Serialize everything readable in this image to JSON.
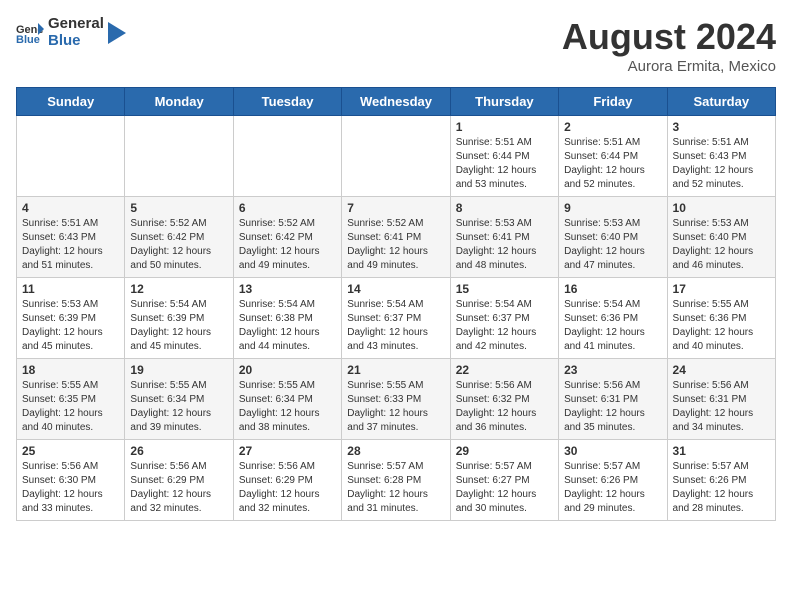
{
  "header": {
    "logo_general": "General",
    "logo_blue": "Blue",
    "month_title": "August 2024",
    "location": "Aurora Ermita, Mexico"
  },
  "weekdays": [
    "Sunday",
    "Monday",
    "Tuesday",
    "Wednesday",
    "Thursday",
    "Friday",
    "Saturday"
  ],
  "weeks": [
    [
      {
        "day": "",
        "info": ""
      },
      {
        "day": "",
        "info": ""
      },
      {
        "day": "",
        "info": ""
      },
      {
        "day": "",
        "info": ""
      },
      {
        "day": "1",
        "info": "Sunrise: 5:51 AM\nSunset: 6:44 PM\nDaylight: 12 hours\nand 53 minutes."
      },
      {
        "day": "2",
        "info": "Sunrise: 5:51 AM\nSunset: 6:44 PM\nDaylight: 12 hours\nand 52 minutes."
      },
      {
        "day": "3",
        "info": "Sunrise: 5:51 AM\nSunset: 6:43 PM\nDaylight: 12 hours\nand 52 minutes."
      }
    ],
    [
      {
        "day": "4",
        "info": "Sunrise: 5:51 AM\nSunset: 6:43 PM\nDaylight: 12 hours\nand 51 minutes."
      },
      {
        "day": "5",
        "info": "Sunrise: 5:52 AM\nSunset: 6:42 PM\nDaylight: 12 hours\nand 50 minutes."
      },
      {
        "day": "6",
        "info": "Sunrise: 5:52 AM\nSunset: 6:42 PM\nDaylight: 12 hours\nand 49 minutes."
      },
      {
        "day": "7",
        "info": "Sunrise: 5:52 AM\nSunset: 6:41 PM\nDaylight: 12 hours\nand 49 minutes."
      },
      {
        "day": "8",
        "info": "Sunrise: 5:53 AM\nSunset: 6:41 PM\nDaylight: 12 hours\nand 48 minutes."
      },
      {
        "day": "9",
        "info": "Sunrise: 5:53 AM\nSunset: 6:40 PM\nDaylight: 12 hours\nand 47 minutes."
      },
      {
        "day": "10",
        "info": "Sunrise: 5:53 AM\nSunset: 6:40 PM\nDaylight: 12 hours\nand 46 minutes."
      }
    ],
    [
      {
        "day": "11",
        "info": "Sunrise: 5:53 AM\nSunset: 6:39 PM\nDaylight: 12 hours\nand 45 minutes."
      },
      {
        "day": "12",
        "info": "Sunrise: 5:54 AM\nSunset: 6:39 PM\nDaylight: 12 hours\nand 45 minutes."
      },
      {
        "day": "13",
        "info": "Sunrise: 5:54 AM\nSunset: 6:38 PM\nDaylight: 12 hours\nand 44 minutes."
      },
      {
        "day": "14",
        "info": "Sunrise: 5:54 AM\nSunset: 6:37 PM\nDaylight: 12 hours\nand 43 minutes."
      },
      {
        "day": "15",
        "info": "Sunrise: 5:54 AM\nSunset: 6:37 PM\nDaylight: 12 hours\nand 42 minutes."
      },
      {
        "day": "16",
        "info": "Sunrise: 5:54 AM\nSunset: 6:36 PM\nDaylight: 12 hours\nand 41 minutes."
      },
      {
        "day": "17",
        "info": "Sunrise: 5:55 AM\nSunset: 6:36 PM\nDaylight: 12 hours\nand 40 minutes."
      }
    ],
    [
      {
        "day": "18",
        "info": "Sunrise: 5:55 AM\nSunset: 6:35 PM\nDaylight: 12 hours\nand 40 minutes."
      },
      {
        "day": "19",
        "info": "Sunrise: 5:55 AM\nSunset: 6:34 PM\nDaylight: 12 hours\nand 39 minutes."
      },
      {
        "day": "20",
        "info": "Sunrise: 5:55 AM\nSunset: 6:34 PM\nDaylight: 12 hours\nand 38 minutes."
      },
      {
        "day": "21",
        "info": "Sunrise: 5:55 AM\nSunset: 6:33 PM\nDaylight: 12 hours\nand 37 minutes."
      },
      {
        "day": "22",
        "info": "Sunrise: 5:56 AM\nSunset: 6:32 PM\nDaylight: 12 hours\nand 36 minutes."
      },
      {
        "day": "23",
        "info": "Sunrise: 5:56 AM\nSunset: 6:31 PM\nDaylight: 12 hours\nand 35 minutes."
      },
      {
        "day": "24",
        "info": "Sunrise: 5:56 AM\nSunset: 6:31 PM\nDaylight: 12 hours\nand 34 minutes."
      }
    ],
    [
      {
        "day": "25",
        "info": "Sunrise: 5:56 AM\nSunset: 6:30 PM\nDaylight: 12 hours\nand 33 minutes."
      },
      {
        "day": "26",
        "info": "Sunrise: 5:56 AM\nSunset: 6:29 PM\nDaylight: 12 hours\nand 32 minutes."
      },
      {
        "day": "27",
        "info": "Sunrise: 5:56 AM\nSunset: 6:29 PM\nDaylight: 12 hours\nand 32 minutes."
      },
      {
        "day": "28",
        "info": "Sunrise: 5:57 AM\nSunset: 6:28 PM\nDaylight: 12 hours\nand 31 minutes."
      },
      {
        "day": "29",
        "info": "Sunrise: 5:57 AM\nSunset: 6:27 PM\nDaylight: 12 hours\nand 30 minutes."
      },
      {
        "day": "30",
        "info": "Sunrise: 5:57 AM\nSunset: 6:26 PM\nDaylight: 12 hours\nand 29 minutes."
      },
      {
        "day": "31",
        "info": "Sunrise: 5:57 AM\nSunset: 6:26 PM\nDaylight: 12 hours\nand 28 minutes."
      }
    ]
  ]
}
